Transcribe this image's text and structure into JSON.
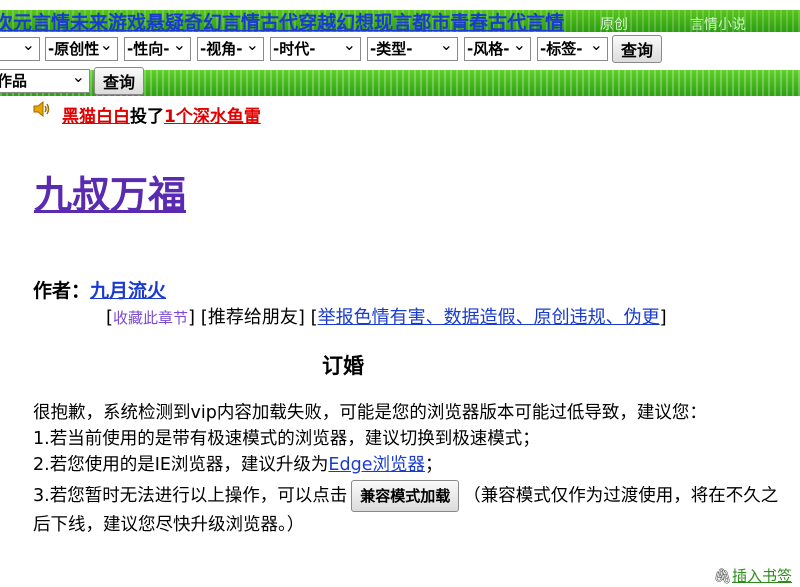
{
  "nav": {
    "links": [
      "次元言情",
      "未来游戏",
      "悬疑奇幻",
      "言情古代",
      "穿越",
      "幻想现言",
      "都市青春",
      "古代言情"
    ],
    "ghost_tabs": [
      "原创",
      "言情小说"
    ]
  },
  "filters": {
    "first_select": "",
    "original": "-原创性",
    "gender": "-性向-",
    "perspective": "-视角-",
    "era": "-时代-",
    "type": "-类型-",
    "style": "-风格-",
    "tag": "-标签-",
    "query_label": "查询"
  },
  "search": {
    "scope_select": "作品",
    "query_label": "查询"
  },
  "notice": {
    "user": "黑猫白白",
    "verb": "投了",
    "gift": "1个深水鱼雷"
  },
  "book": {
    "title": "九叔万福",
    "author_label": "作者：",
    "author": "九月流火"
  },
  "actions": {
    "bookmark_chapter": "收藏此章节",
    "recommend": "[推荐给朋友]",
    "report": "举报色情有害、数据造假、原创违规、伪更"
  },
  "chapter": {
    "title": "订婚"
  },
  "message": {
    "line1": "很抱歉，系统检测到vip内容加载失败，可能是您的浏览器版本可能过低导致，建议您：",
    "line2": "1.若当前使用的是带有极速模式的浏览器，建议切换到极速模式；",
    "line3_pre": "2.若您使用的是IE浏览器，建议升级为",
    "line3_link": "Edge浏览器",
    "line3_post": "；",
    "line4_pre": "3.若您暂时无法进行以上操作，可以点击",
    "compat_button": "兼容模式加载",
    "line4_post": "（兼容模式仅作为过渡使用，将在不久之后下线，建议您尽快升级浏览器。）"
  },
  "footer": {
    "insert_bookmark": "插入书签"
  },
  "colors": {
    "nav_green": "#3aad18",
    "link_blue": "#1a3bd0",
    "alert_red": "#e00000",
    "title_purple": "#5a2bb0"
  }
}
